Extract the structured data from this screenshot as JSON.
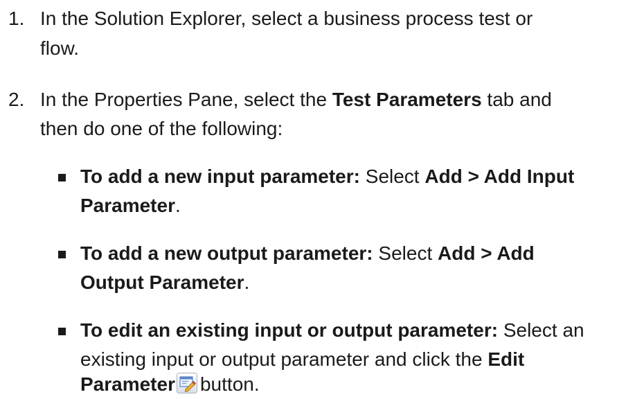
{
  "step1": {
    "number": "1.",
    "line1": "In the Solution Explorer, select a business process test or",
    "line2": "flow."
  },
  "step2": {
    "number": "2.",
    "line1_prefix": "In the Properties Pane, select the ",
    "line1_bold": "Test Parameters",
    "line1_suffix": " tab and",
    "line2": "then do one of the following:",
    "bullets": [
      {
        "lead_bold": "To add a new input parameter:",
        "text1": " Select ",
        "path_bold": "Add > Add Input",
        "line2_bold": "Parameter",
        "line2_suffix": "."
      },
      {
        "lead_bold": "To add a new output parameter:",
        "text1": " Select  ",
        "path_bold": "Add > Add",
        "line2_bold": "Output Parameter",
        "line2_suffix": "."
      },
      {
        "lead_bold": "To edit an existing input or output parameter:",
        "text1": " Select an",
        "line2_text": "existing input or output parameter and click the ",
        "line2_bold": "Edit",
        "line3_bold": "Parameter",
        "icon": "edit-parameter-icon",
        "line3_suffix": "button."
      }
    ]
  }
}
